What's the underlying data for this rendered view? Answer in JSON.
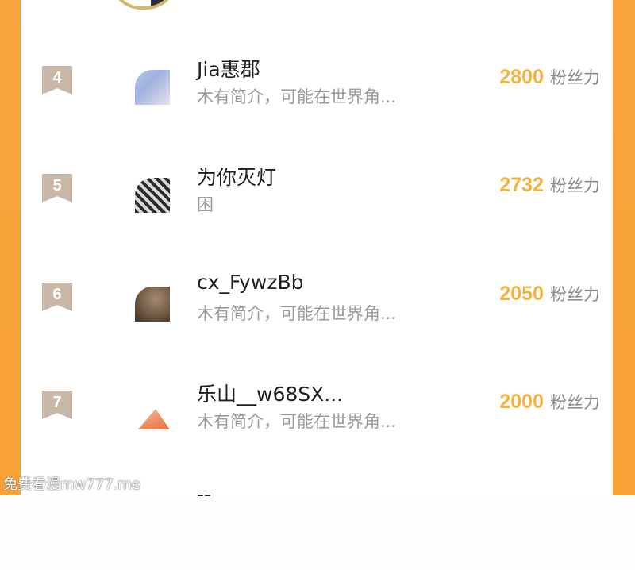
{
  "leaderboard": [
    {
      "rank": "4",
      "name": "Jia惠郡",
      "bio": "木有简介，可能在世界角...",
      "fans": "2800",
      "fans_label": "粉丝力"
    },
    {
      "rank": "5",
      "name": "为你灭灯",
      "bio": "困",
      "fans": "2732",
      "fans_label": "粉丝力"
    },
    {
      "rank": "6",
      "name": "cx_FywzBb",
      "bio": "木有简介，可能在世界角...",
      "fans": "2050",
      "fans_label": "粉丝力"
    },
    {
      "rank": "7",
      "name": "乐山__w68SX...",
      "bio": "木有简介，可能在世界角...",
      "fans": "2000",
      "fans_label": "粉丝力"
    }
  ],
  "partial_next": {
    "name": "--"
  },
  "watermark": "免费看漫mw777.me",
  "colors": {
    "side_orange": "#f9a43e",
    "fans_gold": "#f2b43f",
    "rank_badge": "#c9b8a8",
    "name_text": "#1f1f1f",
    "muted_text": "#9a9a9a"
  }
}
